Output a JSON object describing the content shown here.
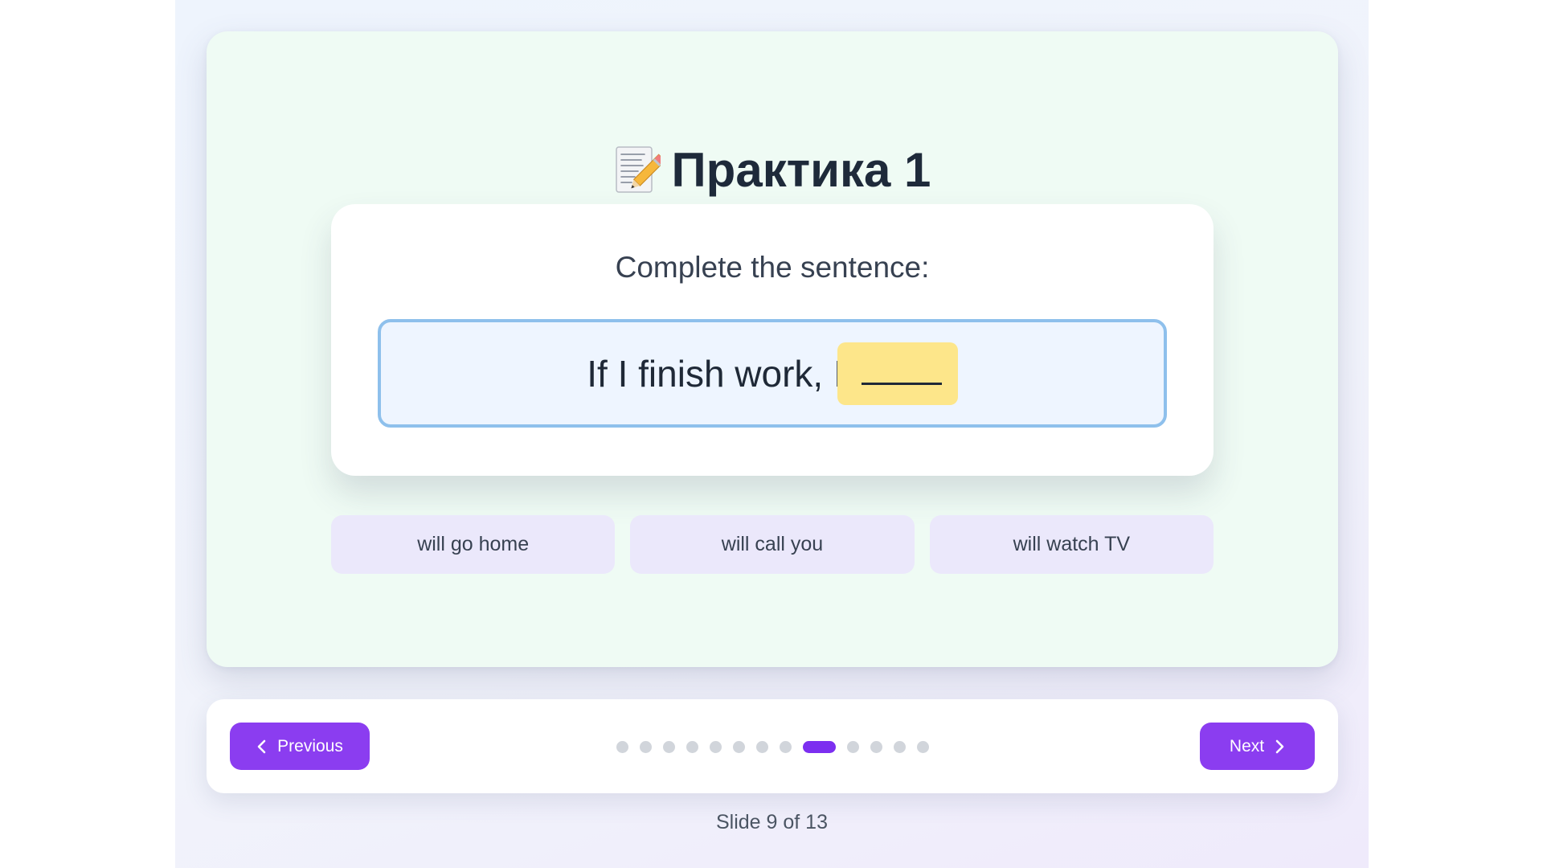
{
  "slide": {
    "title_icon": "memo-pencil-icon",
    "title": "Практика 1",
    "prompt": "Complete the sentence:",
    "sentence": "If I finish work, I",
    "blank": "_____",
    "options": [
      {
        "label": "will go home"
      },
      {
        "label": "will call you"
      },
      {
        "label": "will watch TV"
      }
    ]
  },
  "nav": {
    "previous_label": "Previous",
    "next_label": "Next",
    "total_slides": 13,
    "current_slide": 9,
    "counter_text": "Slide 9 of 13"
  },
  "colors": {
    "accent": "#7c2ff0",
    "button": "#8b3df0",
    "slide_bg": "#effbf4",
    "blank_highlight": "#fde68a",
    "sentence_border": "#8ec0ec",
    "option_bg": "#ebe8fb"
  }
}
